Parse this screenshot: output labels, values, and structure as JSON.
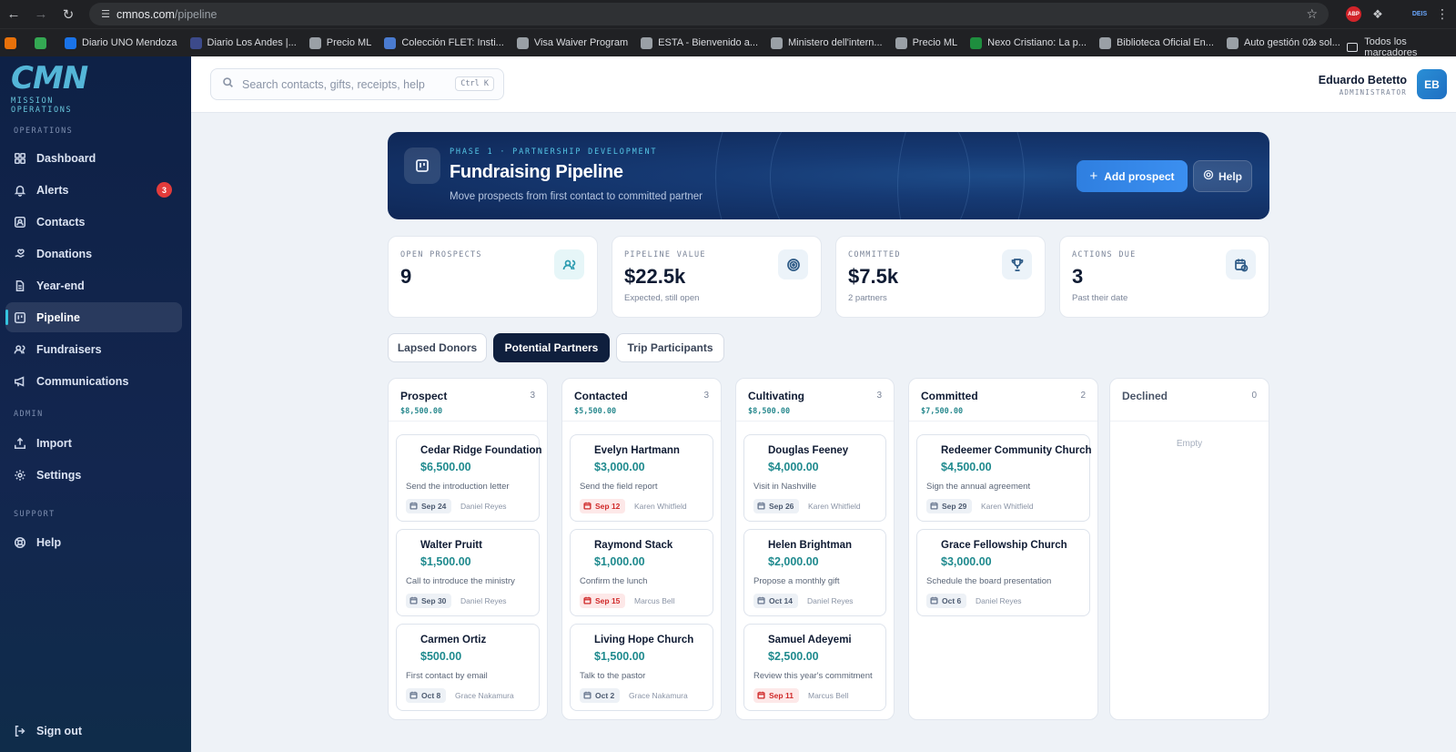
{
  "browser": {
    "url_host": "cmnos.com",
    "url_path": "/pipeline",
    "search_hint": "Ctrl K",
    "bookmarks": [
      {
        "label": "",
        "icon_color": "#e8710a"
      },
      {
        "label": "",
        "icon_color": "#34a853"
      },
      {
        "label": "Diario UNO Mendoza",
        "icon_color": "#1a73e8"
      },
      {
        "label": "Diario Los Andes |...",
        "icon_color": "#3c4a8a"
      },
      {
        "label": "Precio ML",
        "icon_color": "#9aa0a6"
      },
      {
        "label": "Colección FLET: Insti...",
        "icon_color": "#4a7bd0"
      },
      {
        "label": "Visa Waiver Program",
        "icon_color": "#9aa0a6"
      },
      {
        "label": "ESTA - Bienvenido a...",
        "icon_color": "#9aa0a6"
      },
      {
        "label": "Ministero dell'intern...",
        "icon_color": "#9aa0a6"
      },
      {
        "label": "Precio ML",
        "icon_color": "#9aa0a6"
      },
      {
        "label": "Nexo Cristiano: La p...",
        "icon_color": "#1e8e3e"
      },
      {
        "label": "Biblioteca Oficial En...",
        "icon_color": "#9aa0a6"
      },
      {
        "label": "Auto gestión 02: sol...",
        "icon_color": "#9aa0a6"
      }
    ],
    "all_bookmarks_label": "Todos los marcadores",
    "abp_label": "ABP",
    "profile_label": "DEIS"
  },
  "brand": {
    "logo_text": "CMN",
    "subtitle": "MISSION OPERATIONS"
  },
  "sidebar": {
    "sections": [
      {
        "label": "OPERATIONS"
      },
      {
        "label": "ADMIN"
      },
      {
        "label": "SUPPORT"
      }
    ],
    "items": [
      {
        "label": "Dashboard",
        "icon": "grid-icon"
      },
      {
        "label": "Alerts",
        "icon": "bell-icon",
        "badge": "3"
      },
      {
        "label": "Contacts",
        "icon": "contact-icon"
      },
      {
        "label": "Donations",
        "icon": "hand-heart-icon"
      },
      {
        "label": "Year-end",
        "icon": "file-icon"
      },
      {
        "label": "Pipeline",
        "icon": "kanban-icon",
        "active": true
      },
      {
        "label": "Fundraisers",
        "icon": "users-icon"
      },
      {
        "label": "Communications",
        "icon": "megaphone-icon"
      },
      {
        "label": "Import",
        "icon": "upload-icon"
      },
      {
        "label": "Settings",
        "icon": "gear-icon"
      },
      {
        "label": "Help",
        "icon": "lifebuoy-icon"
      }
    ],
    "signout_label": "Sign out"
  },
  "topbar": {
    "search_placeholder": "Search contacts, gifts, receipts, help",
    "shortcut": "Ctrl K",
    "user_name": "Eduardo Betetto",
    "user_role": "ADMINISTRATOR",
    "avatar_initials": "EB"
  },
  "hero": {
    "kicker": "PHASE 1 · PARTNERSHIP DEVELOPMENT",
    "title": "Fundraising Pipeline",
    "subtitle": "Move prospects from first contact to committed partner",
    "add_label": "Add prospect",
    "help_label": "Help"
  },
  "stats": [
    {
      "label": "OPEN PROSPECTS",
      "value": "9",
      "note": "",
      "icon": "users-icon"
    },
    {
      "label": "PIPELINE VALUE",
      "value": "$22.5k",
      "note": "Expected, still open",
      "icon": "target-icon"
    },
    {
      "label": "COMMITTED",
      "value": "$7.5k",
      "note": "2 partners",
      "icon": "trophy-icon"
    },
    {
      "label": "ACTIONS DUE",
      "value": "3",
      "note": "Past their date",
      "icon": "calendar-clock-icon"
    }
  ],
  "tabs": [
    {
      "label": "Lapsed Donors",
      "active": false
    },
    {
      "label": "Potential Partners",
      "active": true
    },
    {
      "label": "Trip Participants",
      "active": false
    }
  ],
  "columns": [
    {
      "title": "Prospect",
      "count": "3",
      "amount": "$8,500.00",
      "cards": [
        {
          "name": "Cedar Ridge Foundation",
          "amount": "$6,500.00",
          "action": "Send the introduction letter",
          "date": "Sep 24",
          "owner": "Daniel Reyes",
          "overdue": false
        },
        {
          "name": "Walter Pruitt",
          "amount": "$1,500.00",
          "action": "Call to introduce the ministry",
          "date": "Sep 30",
          "owner": "Daniel Reyes",
          "overdue": false
        },
        {
          "name": "Carmen Ortiz",
          "amount": "$500.00",
          "action": "First contact by email",
          "date": "Oct 8",
          "owner": "Grace Nakamura",
          "overdue": false
        }
      ]
    },
    {
      "title": "Contacted",
      "count": "3",
      "amount": "$5,500.00",
      "cards": [
        {
          "name": "Evelyn Hartmann",
          "amount": "$3,000.00",
          "action": "Send the field report",
          "date": "Sep 12",
          "owner": "Karen Whitfield",
          "overdue": true
        },
        {
          "name": "Raymond Stack",
          "amount": "$1,000.00",
          "action": "Confirm the lunch",
          "date": "Sep 15",
          "owner": "Marcus Bell",
          "overdue": true
        },
        {
          "name": "Living Hope Church",
          "amount": "$1,500.00",
          "action": "Talk to the pastor",
          "date": "Oct 2",
          "owner": "Grace Nakamura",
          "overdue": false
        }
      ]
    },
    {
      "title": "Cultivating",
      "count": "3",
      "amount": "$8,500.00",
      "cards": [
        {
          "name": "Douglas Feeney",
          "amount": "$4,000.00",
          "action": "Visit in Nashville",
          "date": "Sep 26",
          "owner": "Karen Whitfield",
          "overdue": false
        },
        {
          "name": "Helen Brightman",
          "amount": "$2,000.00",
          "action": "Propose a monthly gift",
          "date": "Oct 14",
          "owner": "Daniel Reyes",
          "overdue": false
        },
        {
          "name": "Samuel Adeyemi",
          "amount": "$2,500.00",
          "action": "Review this year's commitment",
          "date": "Sep 11",
          "owner": "Marcus Bell",
          "overdue": true
        }
      ]
    },
    {
      "title": "Committed",
      "count": "2",
      "amount": "$7,500.00",
      "cards": [
        {
          "name": "Redeemer Community Church",
          "amount": "$4,500.00",
          "action": "Sign the annual agreement",
          "date": "Sep 29",
          "owner": "Karen Whitfield",
          "overdue": false
        },
        {
          "name": "Grace Fellowship Church",
          "amount": "$3,000.00",
          "action": "Schedule the board presentation",
          "date": "Oct 6",
          "owner": "Daniel Reyes",
          "overdue": false
        }
      ]
    },
    {
      "title": "Declined",
      "count": "0",
      "amount": "",
      "empty_label": "Empty",
      "cards": []
    }
  ]
}
